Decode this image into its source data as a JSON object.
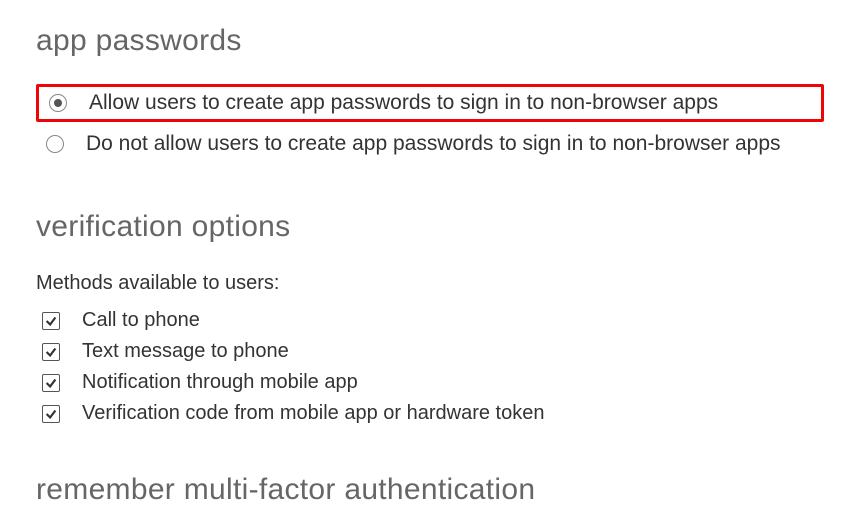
{
  "app_passwords": {
    "heading": "app passwords",
    "options": [
      {
        "label": "Allow users to create app passwords to sign in to non-browser apps",
        "selected": true
      },
      {
        "label": "Do not allow users to create app passwords to sign in to non-browser apps",
        "selected": false
      }
    ]
  },
  "verification_options": {
    "heading": "verification options",
    "sublabel": "Methods available to users:",
    "methods": [
      {
        "label": "Call to phone",
        "checked": true
      },
      {
        "label": "Text message to phone",
        "checked": true
      },
      {
        "label": "Notification through mobile app",
        "checked": true
      },
      {
        "label": "Verification code from mobile app or hardware token",
        "checked": true
      }
    ]
  },
  "remember_mfa": {
    "heading": "remember multi-factor authentication"
  }
}
